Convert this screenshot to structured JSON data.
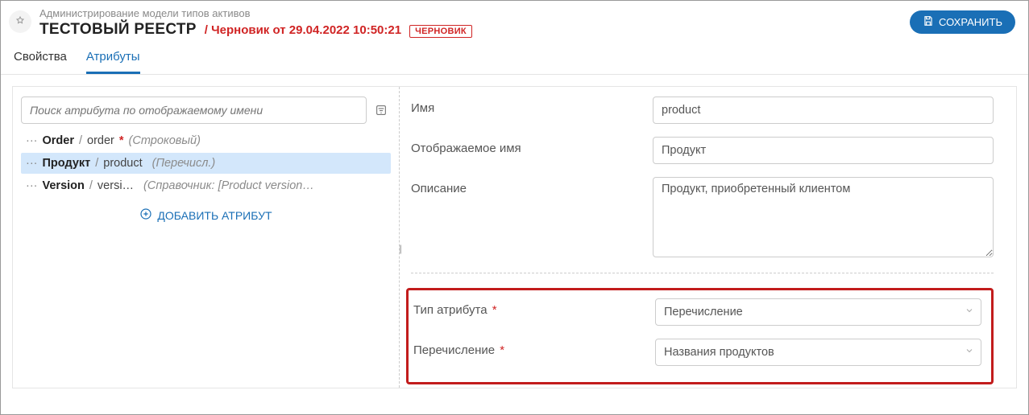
{
  "header": {
    "breadcrumb": "Администрирование модели типов активов",
    "title": "ТЕСТОВЫЙ РЕЕСТР",
    "draft_label": "/ Черновик от 29.04.2022 10:50:21",
    "draft_badge": "ЧЕРНОВИК",
    "save_label": "СОХРАНИТЬ"
  },
  "tabs": {
    "properties": "Свойства",
    "attributes": "Атрибуты"
  },
  "sidebar": {
    "search_placeholder": "Поиск атрибута по отображаемому имени",
    "add_label": "ДОБАВИТЬ АТРИБУТ",
    "items": [
      {
        "display": "Order",
        "code": "order",
        "required": "*",
        "type": "(Строковый)",
        "selected": false
      },
      {
        "display": "Продукт",
        "code": "product",
        "required": "",
        "type": "(Перечисл.)",
        "selected": true
      },
      {
        "display": "Version",
        "code": "versi…",
        "required": "",
        "type": "(Справочник: [Product version…",
        "selected": false
      }
    ]
  },
  "form": {
    "name_label": "Имя",
    "name_value": "product",
    "display_label": "Отображаемое имя",
    "display_value": "Продукт",
    "desc_label": "Описание",
    "desc_value": "Продукт, приобретенный клиентом",
    "type_label": "Тип атрибута",
    "type_value": "Перечисление",
    "enum_label": "Перечисление",
    "enum_value": "Названия продуктов"
  }
}
